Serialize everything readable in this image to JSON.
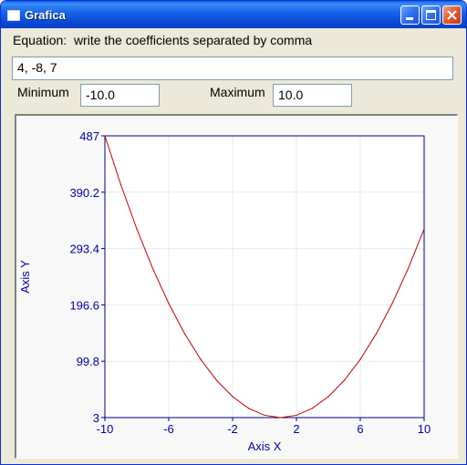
{
  "window": {
    "title": "Grafica"
  },
  "form": {
    "equation_label": "Equation:  write the coefficients separated by comma",
    "equation_value": "4, -8, 7",
    "minimum_label": "Minimum",
    "minimum_value": "-10.0",
    "maximum_label": "Maximum",
    "maximum_value": "10.0"
  },
  "chart_data": {
    "type": "line",
    "xlabel": "Axis X",
    "ylabel": "Axis Y",
    "xlim": [
      -10,
      10
    ],
    "ylim": [
      3,
      487
    ],
    "x_ticks": [
      "-10",
      "-6",
      "-2",
      "2",
      "6",
      "10"
    ],
    "y_ticks": [
      "3",
      "99.8",
      "196.6",
      "293.4",
      "390.2",
      "487"
    ],
    "grid": true,
    "series": [
      {
        "color": "#c00000",
        "x": [
          -10,
          -9,
          -8,
          -7,
          -6,
          -5,
          -4,
          -3,
          -2,
          -1,
          0,
          1,
          2,
          3,
          4,
          5,
          6,
          7,
          8,
          9,
          10
        ],
        "y": [
          487,
          403,
          327,
          259,
          199,
          147,
          103,
          67,
          39,
          19,
          7,
          3,
          7,
          19,
          39,
          67,
          103,
          147,
          199,
          259,
          327
        ]
      }
    ]
  }
}
